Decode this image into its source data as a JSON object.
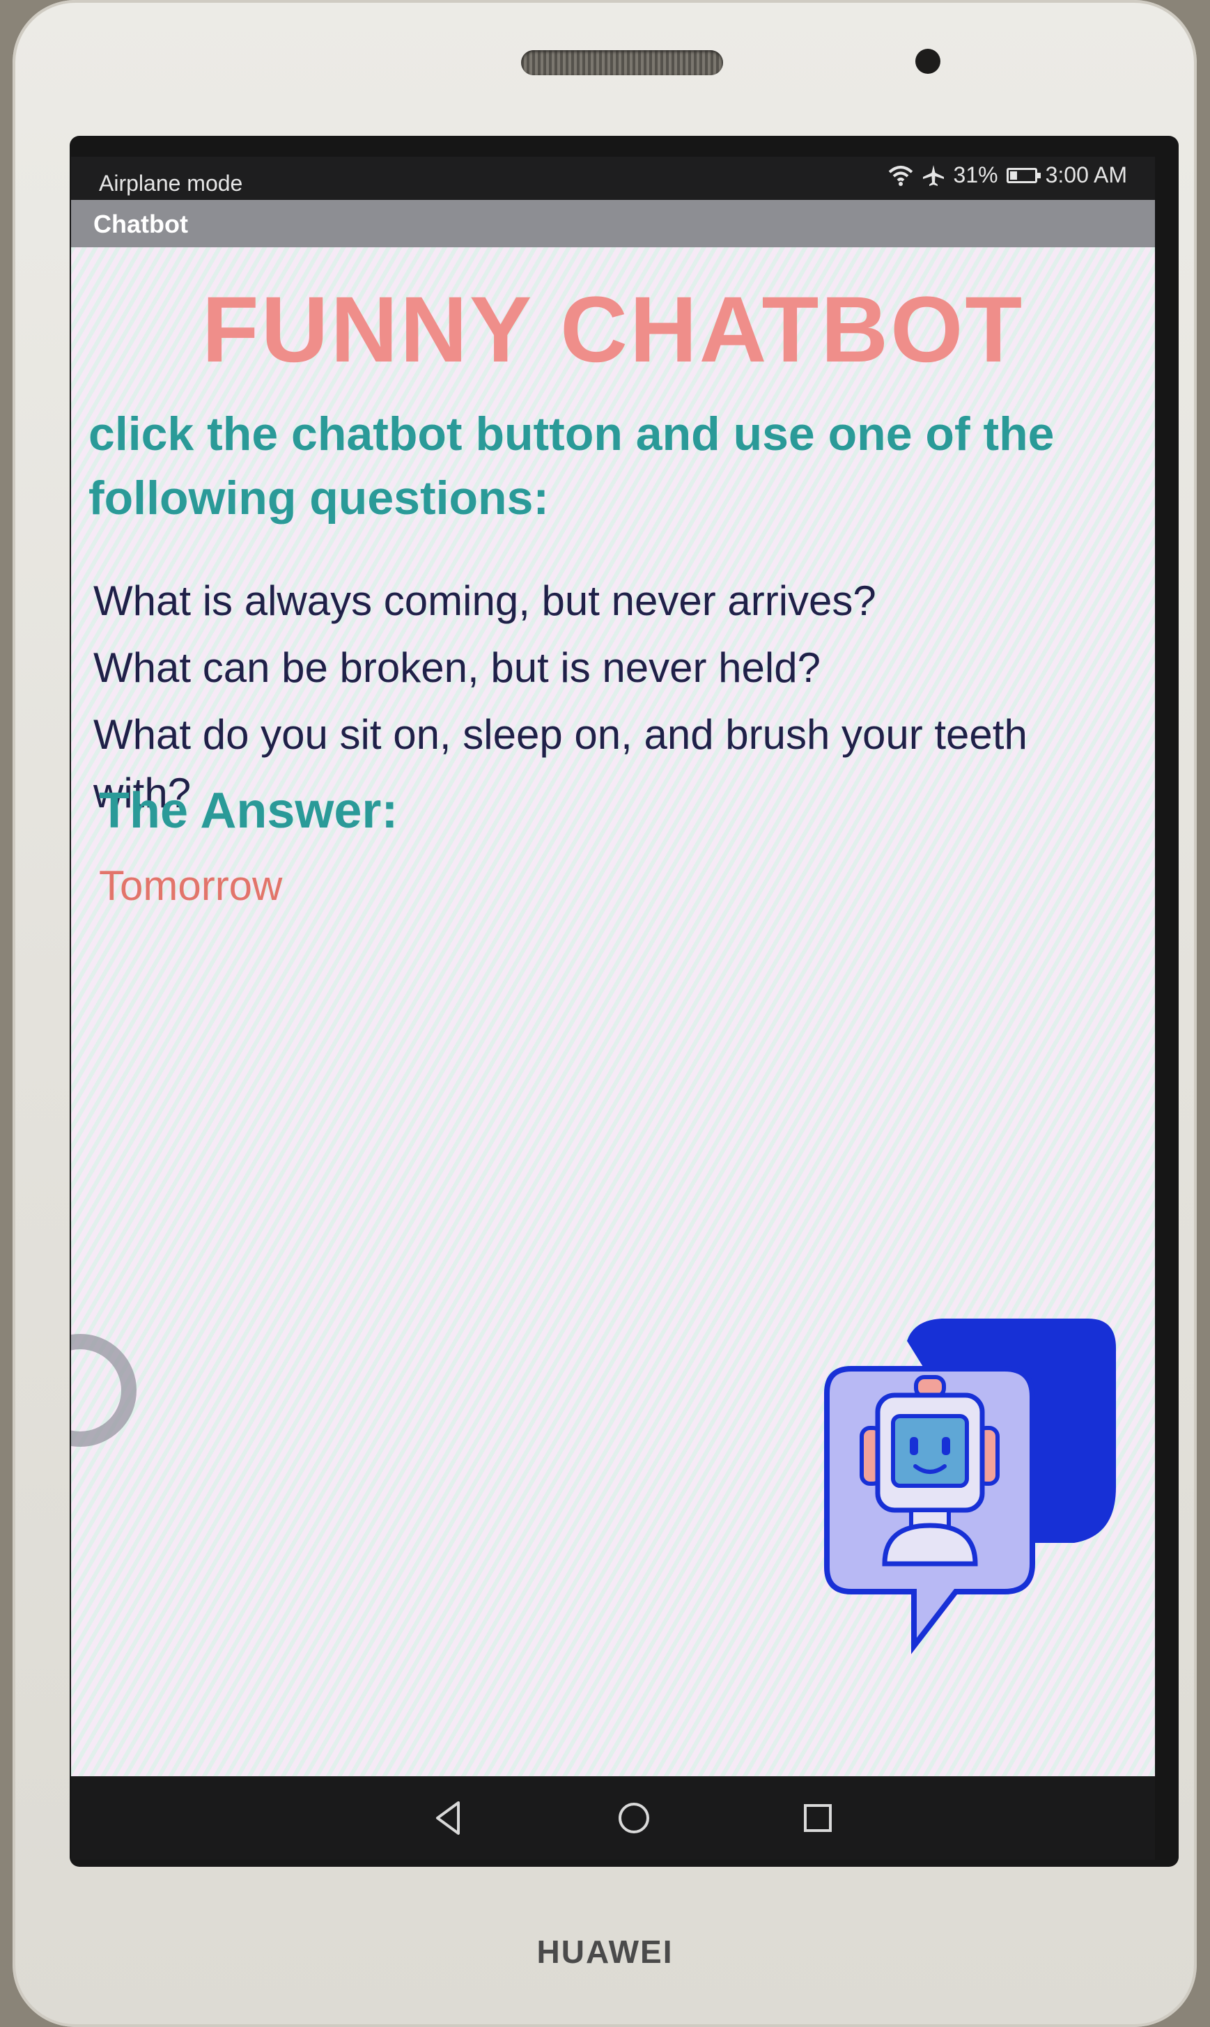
{
  "device": {
    "brand": "HUAWEI"
  },
  "status_bar": {
    "left_text": "Airplane mode",
    "battery": "31%",
    "time": "3:00 AM",
    "icons": [
      "wifi-icon",
      "airplane-icon",
      "battery-icon"
    ]
  },
  "app_bar": {
    "title": "Chatbot"
  },
  "main": {
    "title": "FUNNY CHATBOT",
    "instruction": "click the chatbot button and use one of the following questions:",
    "questions": [
      "What is always coming, but never arrives?",
      "What can be broken, but is never held?",
      "What do you sit on, sleep on, and brush your teeth with?"
    ],
    "answer_heading": "The Answer:",
    "answer": "Tomorrow",
    "chatbot_icon": "robot-chat-icon"
  },
  "nav_bar": {
    "icons": [
      "back-icon",
      "home-icon",
      "recents-icon"
    ]
  },
  "colors": {
    "title": "#ef8e8a",
    "accent_teal": "#2a9a98",
    "question_text": "#1f2048",
    "answer_text": "#e2746a",
    "chatbot_blue": "#1730d6"
  }
}
